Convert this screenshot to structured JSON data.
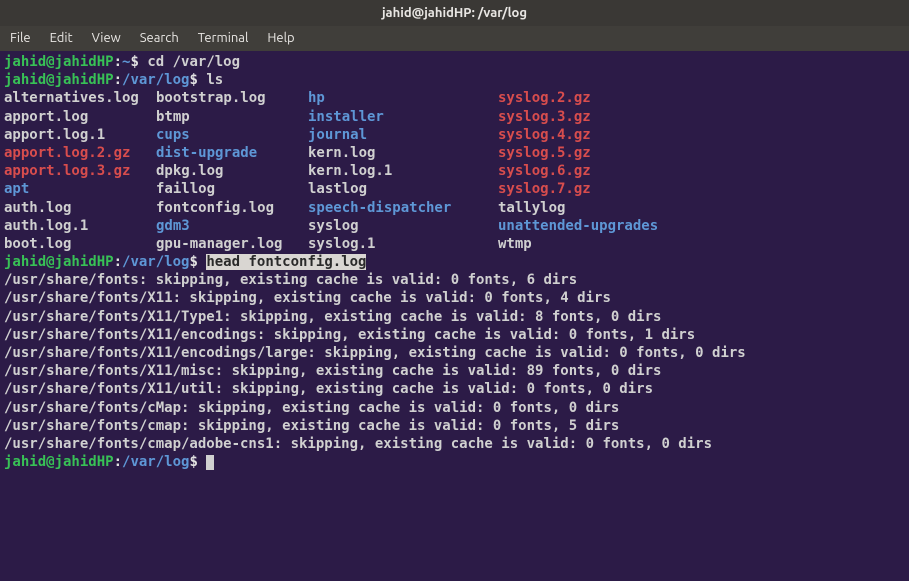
{
  "title": "jahid@jahidHP: /var/log",
  "menu": {
    "items": [
      "File",
      "Edit",
      "View",
      "Search",
      "Terminal",
      "Help"
    ]
  },
  "prompt": {
    "user_host": "jahid@jahidHP",
    "home_path": "~",
    "cwd": "/var/log",
    "sym": "$"
  },
  "cmds": {
    "cd": "cd /var/log",
    "ls": "ls",
    "head": "head fontconfig.log"
  },
  "ls": [
    [
      {
        "t": "alternatives.log",
        "c": "normal"
      },
      {
        "t": "bootstrap.log",
        "c": "normal"
      },
      {
        "t": "hp",
        "c": "dir"
      },
      {
        "t": "syslog.2.gz",
        "c": "gz"
      }
    ],
    [
      {
        "t": "apport.log",
        "c": "normal"
      },
      {
        "t": "btmp",
        "c": "normal"
      },
      {
        "t": "installer",
        "c": "dir"
      },
      {
        "t": "syslog.3.gz",
        "c": "gz"
      }
    ],
    [
      {
        "t": "apport.log.1",
        "c": "normal"
      },
      {
        "t": "cups",
        "c": "dir"
      },
      {
        "t": "journal",
        "c": "dir"
      },
      {
        "t": "syslog.4.gz",
        "c": "gz"
      }
    ],
    [
      {
        "t": "apport.log.2.gz",
        "c": "gz"
      },
      {
        "t": "dist-upgrade",
        "c": "dir"
      },
      {
        "t": "kern.log",
        "c": "normal"
      },
      {
        "t": "syslog.5.gz",
        "c": "gz"
      }
    ],
    [
      {
        "t": "apport.log.3.gz",
        "c": "gz"
      },
      {
        "t": "dpkg.log",
        "c": "normal"
      },
      {
        "t": "kern.log.1",
        "c": "normal"
      },
      {
        "t": "syslog.6.gz",
        "c": "gz"
      }
    ],
    [
      {
        "t": "apt",
        "c": "dir"
      },
      {
        "t": "faillog",
        "c": "normal"
      },
      {
        "t": "lastlog",
        "c": "normal"
      },
      {
        "t": "syslog.7.gz",
        "c": "gz"
      }
    ],
    [
      {
        "t": "auth.log",
        "c": "normal"
      },
      {
        "t": "fontconfig.log",
        "c": "normal"
      },
      {
        "t": "speech-dispatcher",
        "c": "dir"
      },
      {
        "t": "tallylog",
        "c": "normal"
      }
    ],
    [
      {
        "t": "auth.log.1",
        "c": "normal"
      },
      {
        "t": "gdm3",
        "c": "dir"
      },
      {
        "t": "syslog",
        "c": "normal"
      },
      {
        "t": "unattended-upgrades",
        "c": "dir"
      }
    ],
    [
      {
        "t": "boot.log",
        "c": "normal"
      },
      {
        "t": "gpu-manager.log",
        "c": "normal"
      },
      {
        "t": "syslog.1",
        "c": "normal"
      },
      {
        "t": "wtmp",
        "c": "normal"
      }
    ]
  ],
  "head_output": [
    "/usr/share/fonts: skipping, existing cache is valid: 0 fonts, 6 dirs",
    "/usr/share/fonts/X11: skipping, existing cache is valid: 0 fonts, 4 dirs",
    "/usr/share/fonts/X11/Type1: skipping, existing cache is valid: 8 fonts, 0 dirs",
    "/usr/share/fonts/X11/encodings: skipping, existing cache is valid: 0 fonts, 1 dirs",
    "/usr/share/fonts/X11/encodings/large: skipping, existing cache is valid: 0 fonts, 0 dirs",
    "/usr/share/fonts/X11/misc: skipping, existing cache is valid: 89 fonts, 0 dirs",
    "/usr/share/fonts/X11/util: skipping, existing cache is valid: 0 fonts, 0 dirs",
    "/usr/share/fonts/cMap: skipping, existing cache is valid: 0 fonts, 0 dirs",
    "/usr/share/fonts/cmap: skipping, existing cache is valid: 0 fonts, 5 dirs",
    "/usr/share/fonts/cmap/adobe-cns1: skipping, existing cache is valid: 0 fonts, 0 dirs"
  ]
}
